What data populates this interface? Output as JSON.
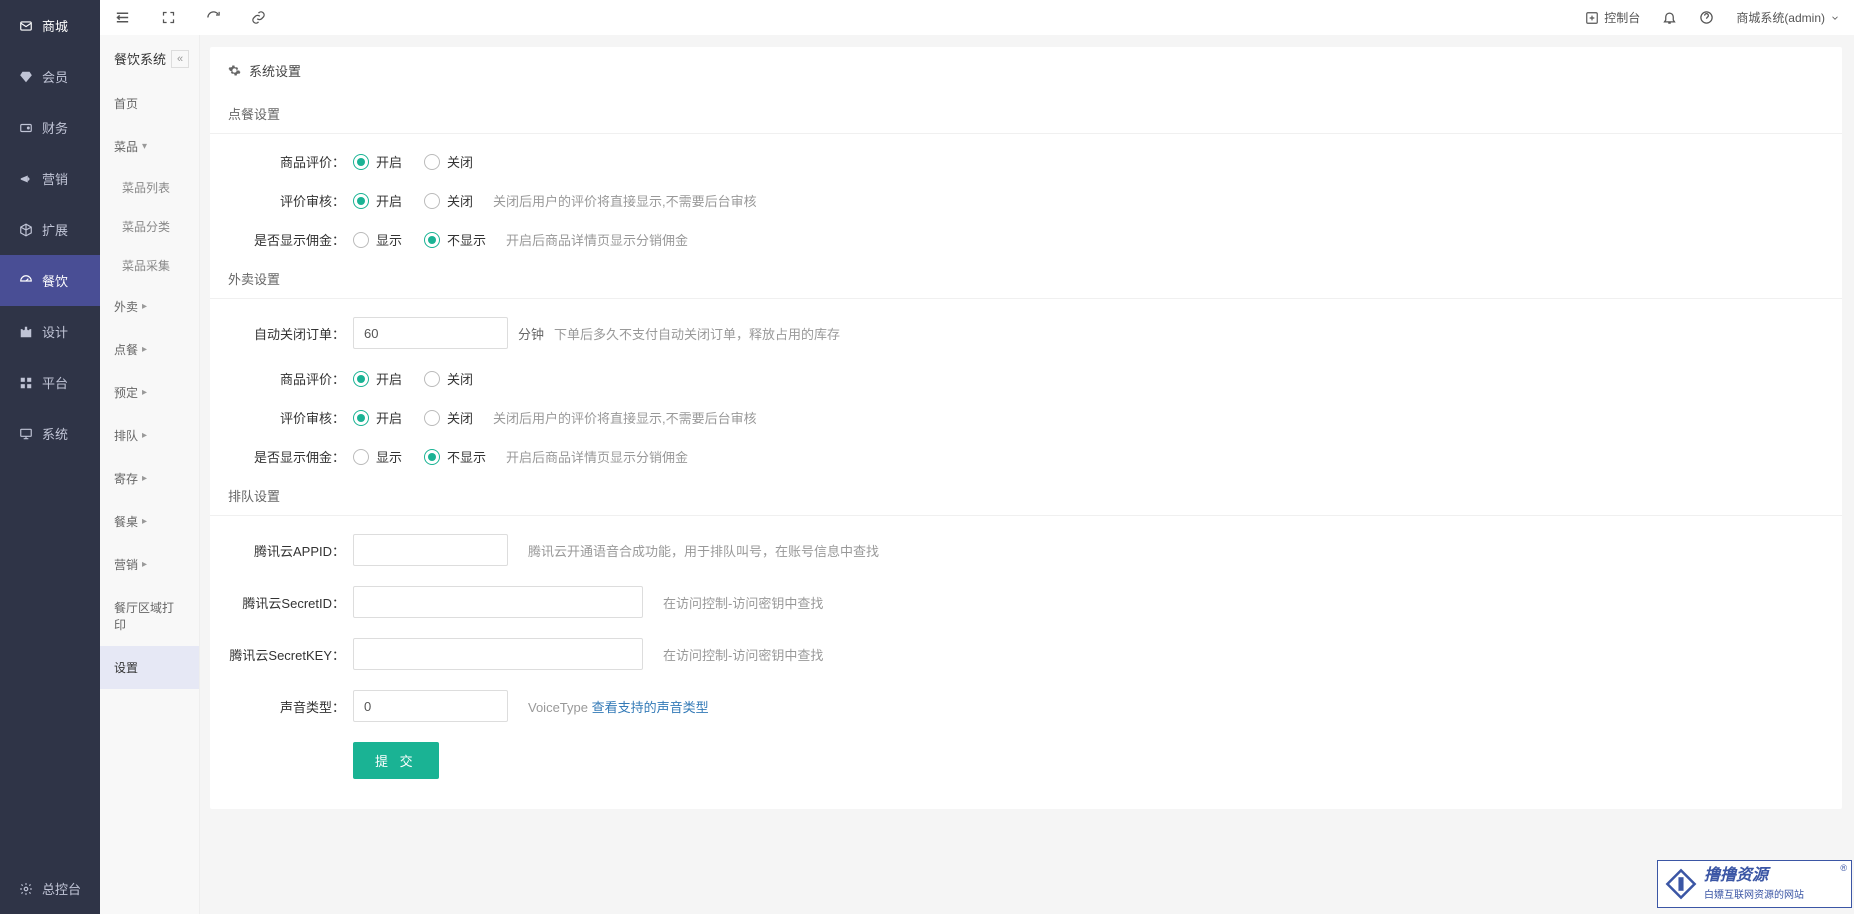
{
  "main_sidebar": {
    "items": [
      {
        "label": "商城"
      },
      {
        "label": "会员"
      },
      {
        "label": "财务"
      },
      {
        "label": "营销"
      },
      {
        "label": "扩展"
      },
      {
        "label": "餐饮"
      },
      {
        "label": "设计"
      },
      {
        "label": "平台"
      },
      {
        "label": "系统"
      }
    ],
    "bottom": {
      "label": "总控台"
    }
  },
  "topbar": {
    "console": "控制台",
    "user": "商城系统(admin)"
  },
  "sub_sidebar": {
    "title": "餐饮系统",
    "items": [
      {
        "label": "首页",
        "caret": false
      },
      {
        "label": "菜品",
        "caret": true,
        "caret_dir": "down",
        "children": [
          {
            "label": "菜品列表"
          },
          {
            "label": "菜品分类"
          },
          {
            "label": "菜品采集"
          }
        ]
      },
      {
        "label": "外卖",
        "caret": true
      },
      {
        "label": "点餐",
        "caret": true
      },
      {
        "label": "预定",
        "caret": true
      },
      {
        "label": "排队",
        "caret": true
      },
      {
        "label": "寄存",
        "caret": true
      },
      {
        "label": "餐桌",
        "caret": true
      },
      {
        "label": "营销",
        "caret": true
      },
      {
        "label": "餐厅区域打印",
        "caret": false
      },
      {
        "label": "设置",
        "caret": false,
        "active": true
      }
    ]
  },
  "panel": {
    "title": "系统设置",
    "sections": {
      "ordering": {
        "title": "点餐设置",
        "product_review": {
          "label": "商品评价：",
          "opt1": "开启",
          "opt2": "关闭"
        },
        "review_audit": {
          "label": "评价审核：",
          "opt1": "开启",
          "opt2": "关闭",
          "hint": "关闭后用户的评价将直接显示,不需要后台审核"
        },
        "show_commission": {
          "label": "是否显示佣金：",
          "opt1": "显示",
          "opt2": "不显示",
          "hint": "开启后商品详情页显示分销佣金"
        }
      },
      "takeout": {
        "title": "外卖设置",
        "auto_close": {
          "label": "自动关闭订单：",
          "value": "60",
          "unit": "分钟",
          "hint": "下单后多久不支付自动关闭订单，释放占用的库存"
        },
        "product_review": {
          "label": "商品评价：",
          "opt1": "开启",
          "opt2": "关闭"
        },
        "review_audit": {
          "label": "评价审核：",
          "opt1": "开启",
          "opt2": "关闭",
          "hint": "关闭后用户的评价将直接显示,不需要后台审核"
        },
        "show_commission": {
          "label": "是否显示佣金：",
          "opt1": "显示",
          "opt2": "不显示",
          "hint": "开启后商品详情页显示分销佣金"
        }
      },
      "queue": {
        "title": "排队设置",
        "appid": {
          "label": "腾讯云APPID：",
          "hint": "腾讯云开通语音合成功能，用于排队叫号，在账号信息中查找"
        },
        "secretid": {
          "label": "腾讯云SecretID：",
          "hint": "在访问控制-访问密钥中查找"
        },
        "secretkey": {
          "label": "腾讯云SecretKEY：",
          "hint": "在访问控制-访问密钥中查找"
        },
        "voice_type": {
          "label": "声音类型：",
          "value": "0",
          "hint_prefix": "VoiceType ",
          "hint_link": "查看支持的声音类型"
        }
      }
    },
    "submit": "提 交"
  },
  "watermark": {
    "title": "撸撸资源",
    "sub": "白嫖互联网资源的网站",
    "reg": "®"
  }
}
